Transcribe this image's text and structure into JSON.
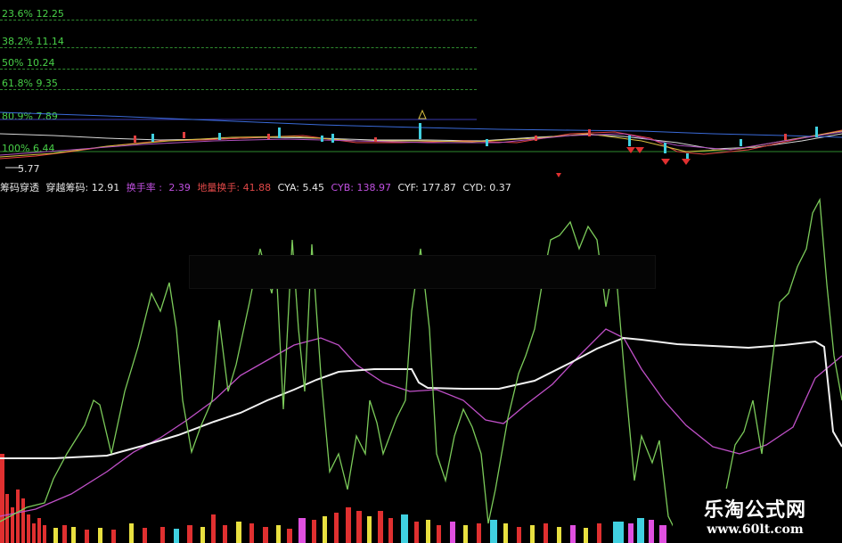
{
  "fib_levels": [
    {
      "label": "23.6% 12.25",
      "color": "#48d048"
    },
    {
      "label": "38.2% 11.14",
      "color": "#48d048"
    },
    {
      "label": "50% 10.24",
      "color": "#48d048"
    },
    {
      "label": "61.8% 9.35",
      "color": "#48d048"
    },
    {
      "label": "80.9% 7.89",
      "color": "#48d048"
    },
    {
      "label": "100% 6.44",
      "color": "#48d048"
    }
  ],
  "price_low_label": "5.77",
  "indicator_bar": {
    "name": "筹码穿透",
    "cross": "穿越筹码: 12.91",
    "turnover": "换手率 :",
    "turnover_value": "2.39",
    "volume_turnover": "地量换手: 41.88",
    "cya": "CYA: 5.45",
    "cyb": "CYB: 138.97",
    "cyf": "CYF: 177.87",
    "cyd": "CYD: 0.37"
  },
  "watermark": {
    "title": "乐淘公式网",
    "url": "www.60lt.com"
  },
  "colors": {
    "background": "#000000",
    "cyf_line": "#7ccb5a",
    "cyb_line": "#c050c8",
    "cya_line": "#f2f2f2",
    "fib_text": "#48d048"
  }
}
